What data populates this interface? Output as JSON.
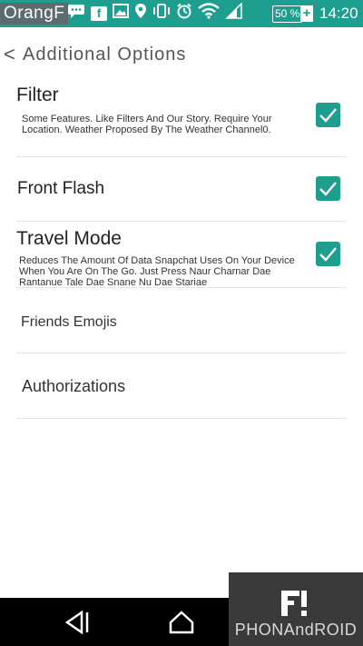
{
  "status_bar": {
    "carrier": "OrangF",
    "icons": [
      "chat-icon",
      "facebook-icon",
      "image-icon",
      "location-icon",
      "vibrate-icon",
      "alarm-icon",
      "wifi-icon",
      "signal-icon"
    ],
    "battery": "50 %",
    "time": "14:20"
  },
  "header": {
    "back_symbol": "<",
    "title": "Additional Options"
  },
  "options": [
    {
      "title": "Filter",
      "description": "Some Features. Like Filters And Our Story. Require Your Location. Weather Proposed By The Weather Channel0.",
      "checked": true
    },
    {
      "title": "Front Flash",
      "description": "",
      "checked": true
    },
    {
      "title": "Travel Mode",
      "description": "Reduces The Amount Of Data Snapchat Uses On Your Device When You Are On The Go. Just Press Naur Charnar Dae Rantanue Tale Dae Snane Nu Dae Stariae",
      "checked": true
    },
    {
      "title": "Friends Emojis"
    },
    {
      "title": "Authorizations"
    }
  ],
  "nav_bar": {
    "buttons": [
      "back",
      "home"
    ]
  },
  "watermark": {
    "logo": "F!",
    "text": "PHONAndROID"
  },
  "colors": {
    "accent": "#1e9e8e",
    "status_bar": "#1e9e8e",
    "nav_bar": "#000000"
  }
}
